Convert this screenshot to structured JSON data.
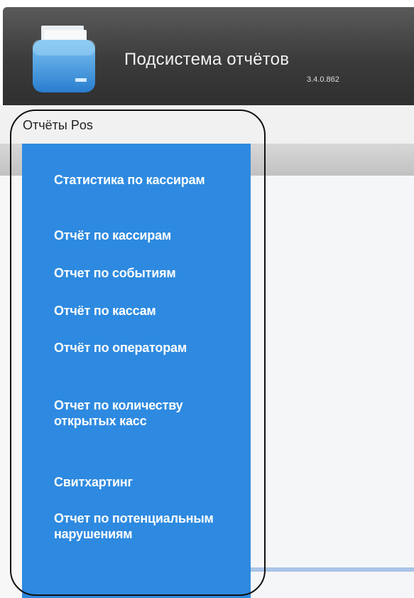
{
  "app": {
    "title": "Подсистема отчётов",
    "version": "3.4.0.862"
  },
  "menu": {
    "section_title": "Отчёты Pos",
    "items": [
      {
        "label": "Статистика по кассирам"
      },
      {
        "label": "Отчёт по кассирам"
      },
      {
        "label": "Отчет по событиям"
      },
      {
        "label": "Отчёт по кассам"
      },
      {
        "label": "Отчёт по операторам"
      },
      {
        "label": "Отчет по количеству открытых касс"
      },
      {
        "label": "Свитхартинг"
      },
      {
        "label": "Отчет по потенциальным нарушениям"
      }
    ]
  },
  "colors": {
    "panel": "#2e8ae0",
    "header": "#3b3b3b",
    "highlight_outline": "#111111"
  }
}
